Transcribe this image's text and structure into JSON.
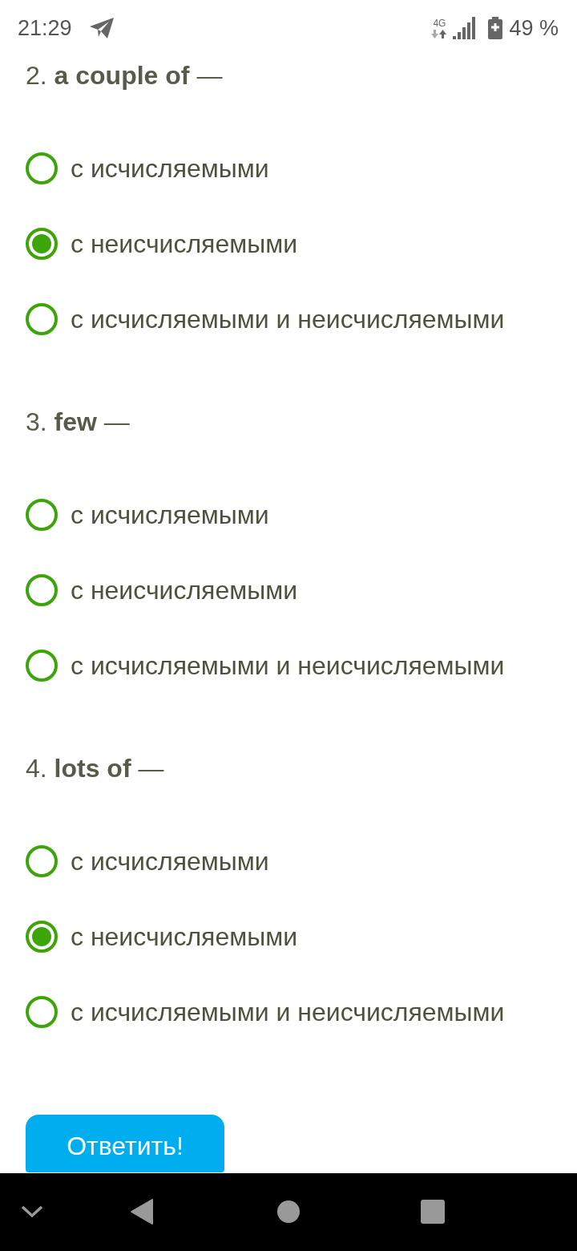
{
  "status_bar": {
    "time": "21:29",
    "network": "4G",
    "battery": "49 %"
  },
  "questions": [
    {
      "text": "2. **a couple of** —",
      "options": [
        {
          "label": "с исчисляемыми",
          "selected": false
        },
        {
          "label": "с неисчисляемыми",
          "selected": true
        },
        {
          "label": "с исчисляемыми и неисчисляемыми",
          "selected": false
        }
      ]
    },
    {
      "text": "3. **few** —",
      "options": [
        {
          "label": "с исчисляемыми",
          "selected": false
        },
        {
          "label": "с неисчисляемыми",
          "selected": false
        },
        {
          "label": "с исчисляемыми и неисчисляемыми",
          "selected": false
        }
      ]
    },
    {
      "text": "4. **lots of** —",
      "options": [
        {
          "label": "с исчисляемыми",
          "selected": false
        },
        {
          "label": "с неисчисляемыми",
          "selected": true
        },
        {
          "label": "с исчисляемыми и неисчисляемыми",
          "selected": false
        }
      ]
    }
  ],
  "submit_button": {
    "label": "Ответить!"
  }
}
